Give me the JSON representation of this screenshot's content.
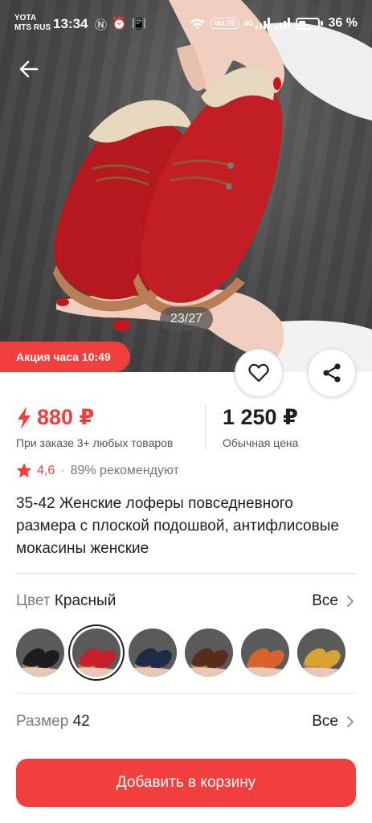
{
  "status_bar": {
    "carrier_line1": "YOTA",
    "carrier_line2": "MTS RUS",
    "time": "13:34",
    "volte": "VoLTE",
    "network": "4G",
    "battery": "36 %"
  },
  "gallery": {
    "counter": "23/27"
  },
  "promo": {
    "label": "Акция часа 10:49"
  },
  "price": {
    "sale": "880 ₽",
    "sale_note": "При заказе 3+ любых товаров",
    "regular": "1 250 ₽",
    "regular_note": "Обычная цена"
  },
  "rating": {
    "value": "4,6",
    "separator": "·",
    "recommend": "89% рекомендуют"
  },
  "product": {
    "title": "35-42 Женские лоферы повседневного размера с плоской подошвой, антифлисовые мокасины женские"
  },
  "color": {
    "label": "Цвет",
    "value": "Красный",
    "all": "Все",
    "swatches": [
      {
        "name": "black",
        "color": "#1c1c1e"
      },
      {
        "name": "red",
        "color": "#c8202a"
      },
      {
        "name": "navy",
        "color": "#1d2a4a"
      },
      {
        "name": "brown",
        "color": "#5a2a1c"
      },
      {
        "name": "orange",
        "color": "#d9622a"
      },
      {
        "name": "yellow",
        "color": "#d9a334"
      }
    ]
  },
  "size": {
    "label": "Размер",
    "value": "42",
    "all": "Все"
  },
  "cta": {
    "add_to_cart": "Добавить в корзину"
  },
  "colors": {
    "accent": "#f33e3e",
    "text": "#1f1f1f",
    "muted": "#7b7b88"
  }
}
